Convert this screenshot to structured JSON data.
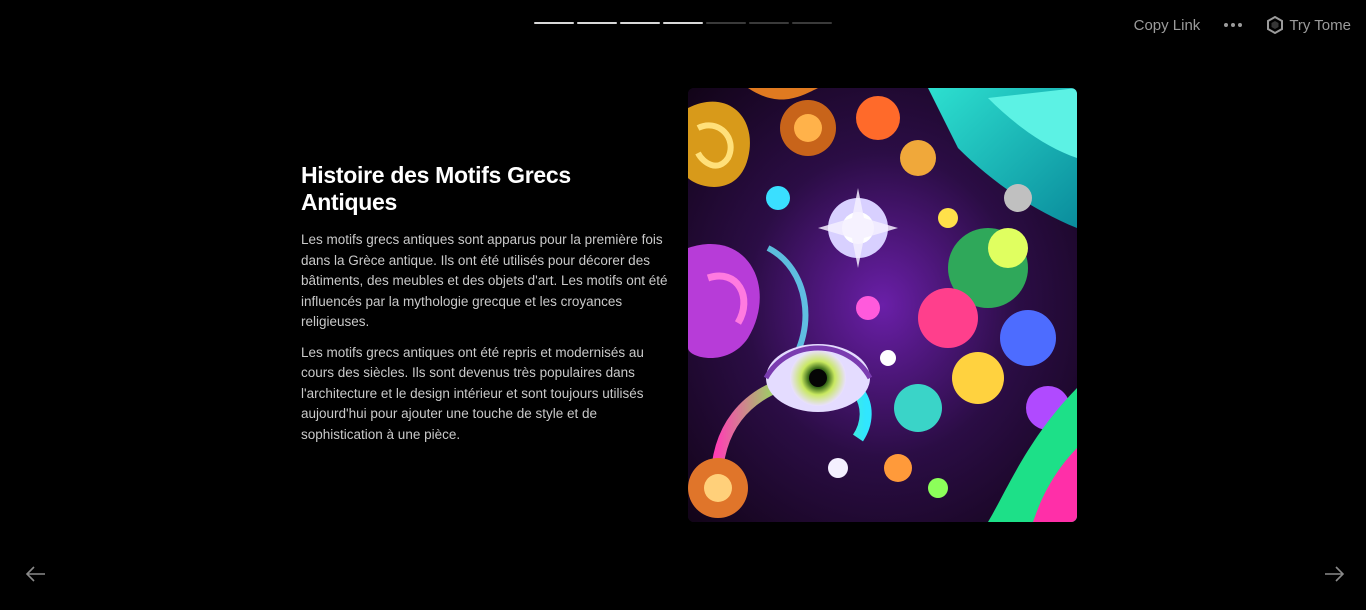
{
  "progress": {
    "total_segments": 7,
    "completed_segments": 4
  },
  "toolbar": {
    "copy_link_label": "Copy Link",
    "try_tome_label": "Try Tome"
  },
  "slide": {
    "title": "Histoire des Motifs Grecs Antiques",
    "paragraphs": [
      "Les motifs grecs antiques sont apparus pour la première fois dans la Grèce antique. Ils ont été utilisés pour décorer des bâtiments, des meubles et des objets d'art. Les motifs ont été influencés par la mythologie grecque et les croyances religieuses.",
      "Les motifs grecs antiques ont été repris et modernisés au cours des siècles. Ils sont devenus très populaires dans l'architecture et le design intérieur et sont toujours utilisés aujourd'hui pour ajouter une touche de style et de sophistication à une pièce."
    ]
  },
  "icons": {
    "more": "more-horizontal-icon",
    "tome": "tome-logo-icon",
    "prev": "arrow-left-icon",
    "next": "arrow-right-icon"
  },
  "colors": {
    "background": "#000000",
    "muted_text": "#9b9b9b",
    "body_text": "#c9c9c9",
    "progress_done": "#d8d8d8",
    "progress_pending": "#3a3a3a"
  }
}
